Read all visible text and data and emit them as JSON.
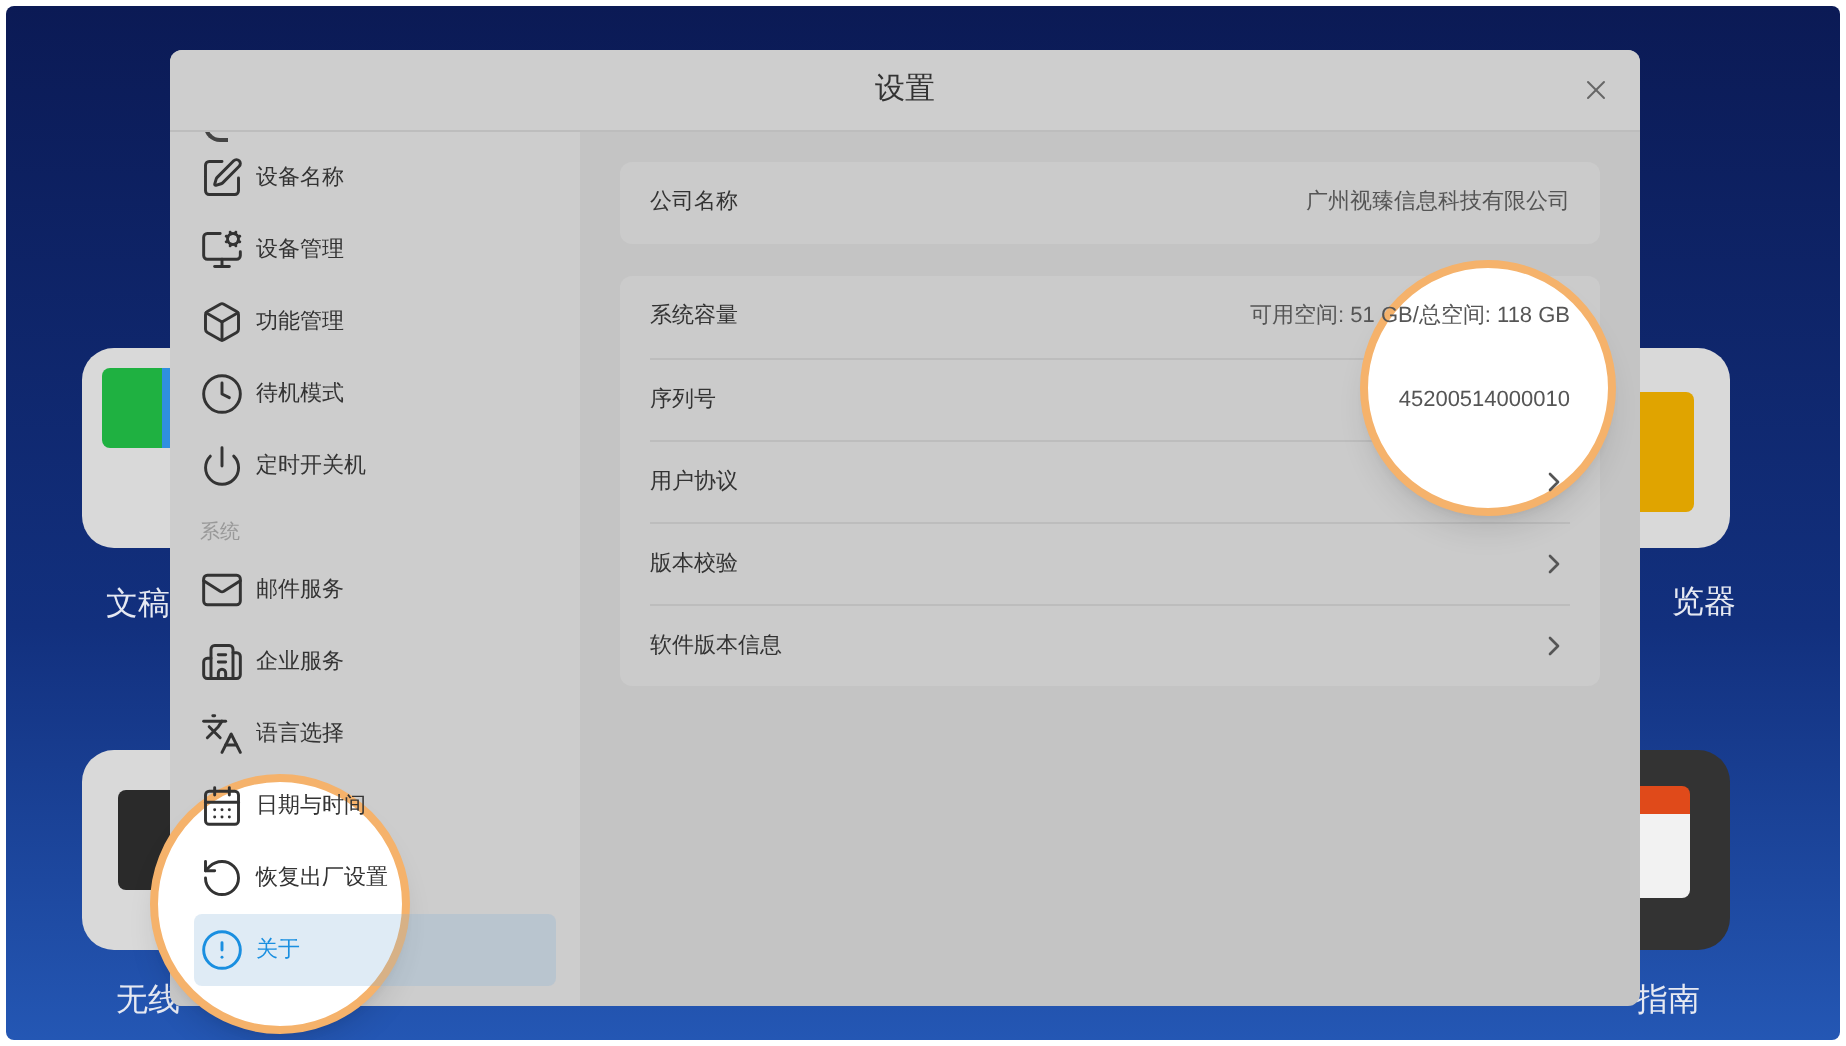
{
  "desktop": {
    "apps": [
      {
        "label": "文稿"
      },
      {
        "label": "览器"
      },
      {
        "label": "无线"
      },
      {
        "label": "指南"
      }
    ]
  },
  "window": {
    "title": "设置"
  },
  "sidebar": {
    "sections": [
      {
        "items": [
          {
            "label": "设备名称",
            "selected": false
          },
          {
            "label": "设备管理",
            "selected": false
          },
          {
            "label": "功能管理",
            "selected": false
          },
          {
            "label": "待机模式",
            "selected": false
          },
          {
            "label": "定时开关机",
            "selected": false
          }
        ]
      },
      {
        "header": "系统",
        "items": [
          {
            "label": "邮件服务",
            "selected": false
          },
          {
            "label": "企业服务",
            "selected": false
          },
          {
            "label": "语言选择",
            "selected": false
          },
          {
            "label": "日期与时间",
            "selected": false
          },
          {
            "label": "恢复出厂设置",
            "selected": false
          },
          {
            "label": "关于",
            "selected": true
          }
        ]
      }
    ]
  },
  "content": {
    "cards": [
      {
        "rows": [
          {
            "kind": "value",
            "label": "公司名称",
            "value": "广州视臻信息科技有限公司"
          }
        ]
      },
      {
        "rows": [
          {
            "kind": "value",
            "label": "系统容量",
            "value": "可用空间: 51 GB/总空间: 118 GB"
          },
          {
            "kind": "value",
            "label": "序列号",
            "value": "45200514000010"
          },
          {
            "kind": "link",
            "label": "用户协议"
          },
          {
            "kind": "link",
            "label": "版本校验"
          },
          {
            "kind": "link",
            "label": "软件版本信息"
          }
        ]
      }
    ]
  }
}
